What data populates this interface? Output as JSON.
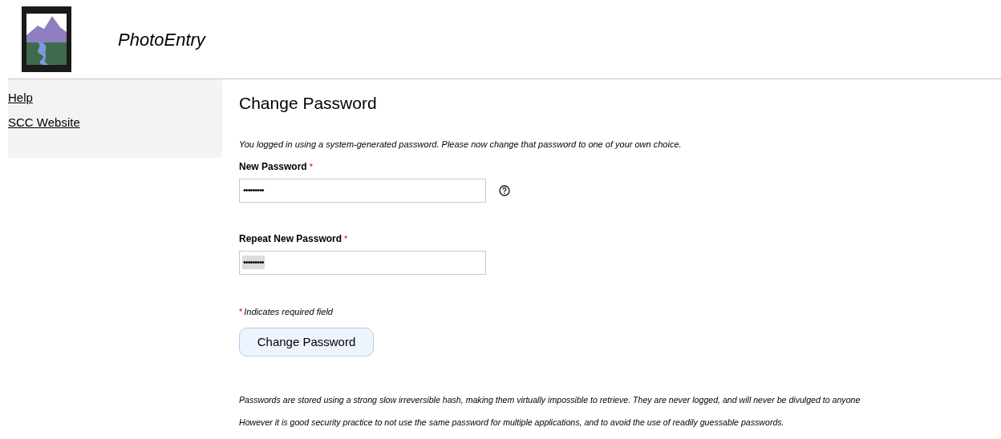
{
  "header": {
    "app_title": "PhotoEntry"
  },
  "sidebar": {
    "links": [
      {
        "label": "Help"
      },
      {
        "label": "SCC Website"
      }
    ]
  },
  "form": {
    "heading": "Change Password",
    "intro": "You logged in using a system-generated password. Please now change that password to one of your own choice.",
    "fields": [
      {
        "label": "New Password",
        "required_mark": "*",
        "value": "•••••••••",
        "highlighted": false,
        "help_icon": true
      },
      {
        "label": "Repeat New Password",
        "required_mark": "*",
        "value": "•••••••••",
        "highlighted": true,
        "help_icon": false
      }
    ],
    "required_note": {
      "mark": "*",
      "text": "Indicates required field"
    },
    "submit": "Change Password",
    "notes": [
      "Passwords are stored using a strong slow irreversible hash, making them virtually impossible to retrieve. They are never logged, and will never be divulged to anyone",
      "However it is good security practice to not use the same password for multiple applications, and to avoid the use of readily guessable passwords."
    ]
  }
}
